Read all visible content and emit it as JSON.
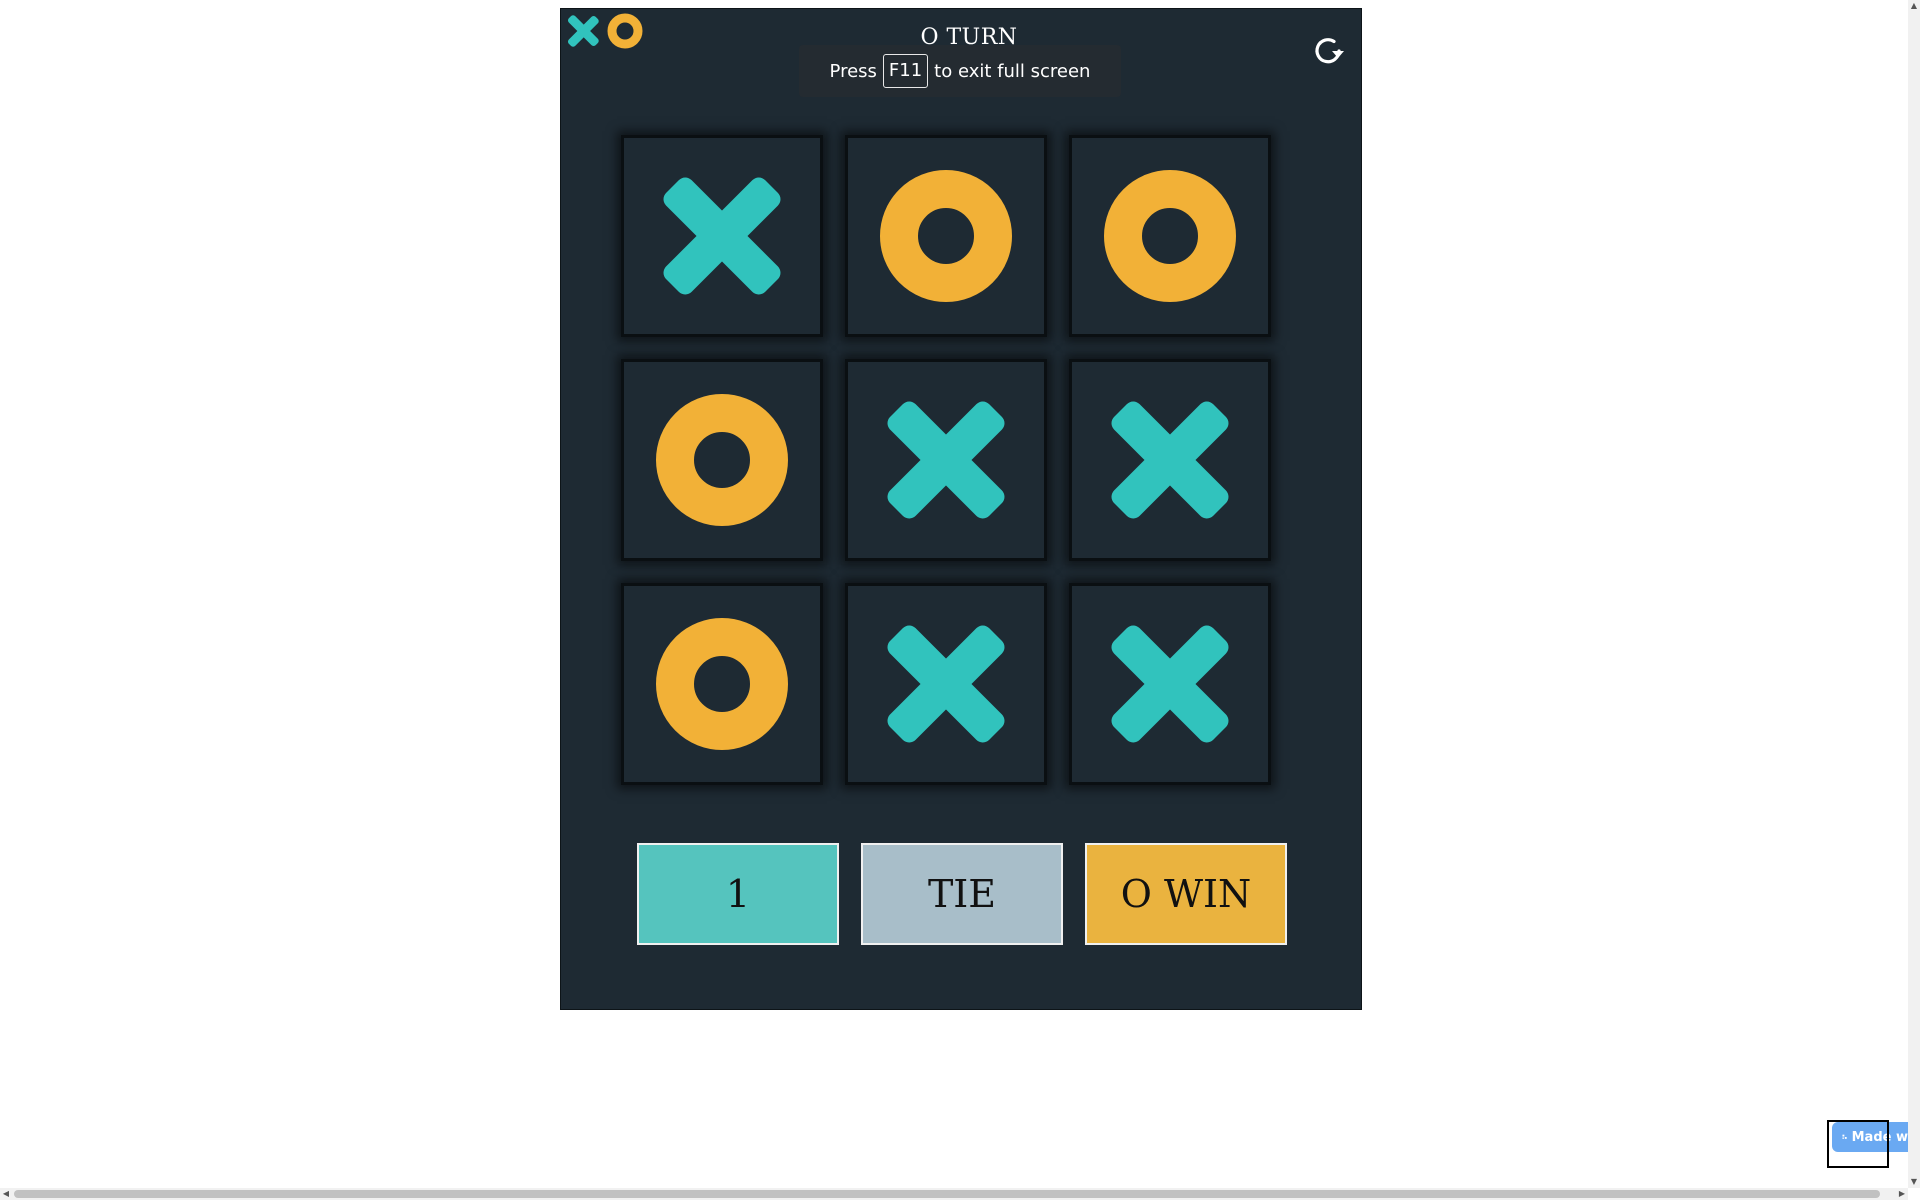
{
  "game": {
    "turn_title": "O TURN",
    "board": [
      "X",
      "O",
      "O",
      "O",
      "X",
      "X",
      "O",
      "X",
      "X"
    ],
    "colors": {
      "x": "#31c3bd",
      "o": "#f2b137",
      "background": "#1e2a33"
    }
  },
  "toast": {
    "press": "Press",
    "key": "F11",
    "rest": "to exit full screen"
  },
  "scores": {
    "x_score": "1",
    "tie_label": "TIE",
    "o_label": "O WIN",
    "colors": {
      "x": "#55c4be",
      "tie": "#a8bec9",
      "o": "#eab33f"
    }
  },
  "badge": {
    "label": "Made w"
  },
  "icons": {
    "logo": "xo-logo-icon",
    "restart": "restart-icon"
  }
}
